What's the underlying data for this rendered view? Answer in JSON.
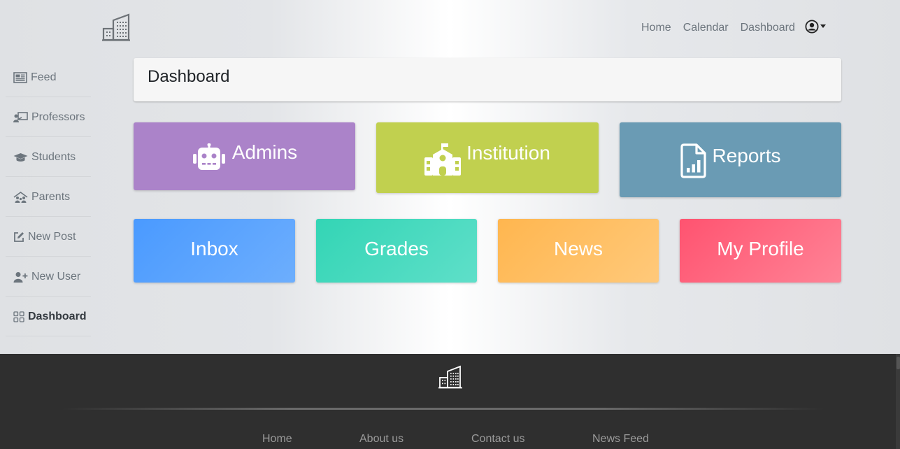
{
  "nav": {
    "links": [
      "Home",
      "Calendar",
      "Dashboard"
    ],
    "user_icon": "user-circle-icon"
  },
  "sidebar": {
    "items": [
      {
        "label": "Feed",
        "icon": "newspaper-icon"
      },
      {
        "label": "Professors",
        "icon": "chalkboard-teacher-icon"
      },
      {
        "label": "Students",
        "icon": "graduation-cap-icon"
      },
      {
        "label": "Parents",
        "icon": "family-house-icon"
      },
      {
        "label": "New Post",
        "icon": "edit-icon"
      },
      {
        "label": "New User",
        "icon": "user-plus-icon"
      },
      {
        "label": "Dashboard",
        "icon": "grid-icon",
        "active": true
      }
    ]
  },
  "page": {
    "title": "Dashboard"
  },
  "tiles": {
    "admins": {
      "label": "Admins",
      "icon": "robot-icon",
      "color": "#ab83c9"
    },
    "institution": {
      "label": "Institution",
      "icon": "school-icon",
      "color": "#c1d04f"
    },
    "reports": {
      "label": "Reports",
      "icon": "file-chart-icon",
      "color": "#6a9bb4"
    },
    "inbox": {
      "label": "Inbox",
      "color": "#4a9aff"
    },
    "grades": {
      "label": "Grades",
      "color": "#33d5b5"
    },
    "news": {
      "label": "News",
      "color": "#ffb64f"
    },
    "profile": {
      "label": "My Profile",
      "color": "#ff5370"
    }
  },
  "footer": {
    "links": [
      "Home",
      "About us",
      "Contact us",
      "News Feed"
    ],
    "logo_icon": "building-icon"
  }
}
